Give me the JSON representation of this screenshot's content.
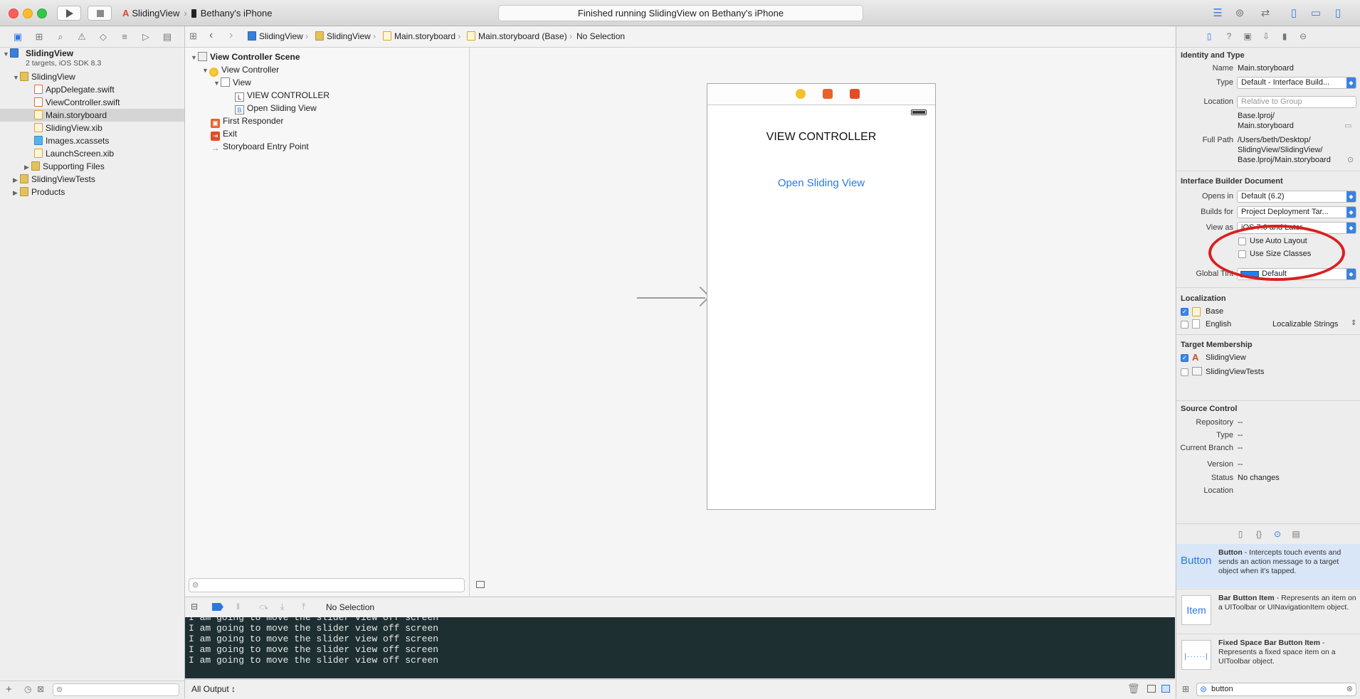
{
  "toolbar": {
    "scheme": "SlidingView",
    "device": "Bethany's iPhone",
    "activity": "Finished running SlidingView on Bethany's iPhone"
  },
  "navigator": {
    "project": {
      "name": "SlidingView",
      "subtitle": "2 targets, iOS SDK 8.3"
    },
    "items": [
      {
        "label": "SlidingView",
        "kind": "folder"
      },
      {
        "label": "AppDelegate.swift",
        "kind": "swift"
      },
      {
        "label": "ViewController.swift",
        "kind": "swift"
      },
      {
        "label": "Main.storyboard",
        "kind": "storyboard"
      },
      {
        "label": "SlidingView.xib",
        "kind": "xib"
      },
      {
        "label": "Images.xcassets",
        "kind": "assets"
      },
      {
        "label": "LaunchScreen.xib",
        "kind": "xib"
      },
      {
        "label": "Supporting Files",
        "kind": "folder"
      },
      {
        "label": "SlidingViewTests",
        "kind": "folder"
      },
      {
        "label": "Products",
        "kind": "folder"
      }
    ]
  },
  "jumpbar": [
    "SlidingView",
    "SlidingView",
    "Main.storyboard",
    "Main.storyboard (Base)",
    "No Selection"
  ],
  "outline": {
    "scene": "View Controller Scene",
    "view_controller": "View Controller",
    "view": "View",
    "label": "VIEW CONTROLLER",
    "button": "Open Sliding View",
    "first_responder": "First Responder",
    "exit": "Exit",
    "entry_point": "Storyboard Entry Point"
  },
  "canvas": {
    "title_label": "VIEW CONTROLLER",
    "button_label": "Open Sliding View"
  },
  "debug": {
    "selection": "No Selection",
    "console_lines": [
      "I am going to move the slider view off screen",
      "I am going to move the slider view off screen",
      "I am going to move the slider view off screen",
      "I am going to move the slider view off screen",
      "I am going to move the slider view off screen"
    ],
    "output_filter": "All Output ↕"
  },
  "inspector": {
    "identity": {
      "title": "Identity and Type",
      "name_label": "Name",
      "name": "Main.storyboard",
      "type_label": "Type",
      "type": "Default - Interface Build...",
      "location_label": "Location",
      "location": "Relative to Group",
      "location_path_1": "Base.lproj/",
      "location_path_2": "Main.storyboard",
      "full_path_label": "Full Path",
      "full_path_1": "/Users/beth/Desktop/",
      "full_path_2": "SlidingView/SlidingView/",
      "full_path_3": "Base.lproj/Main.storyboard"
    },
    "ib_document": {
      "title": "Interface Builder Document",
      "opens_in_label": "Opens in",
      "opens_in": "Default (6.2)",
      "builds_for_label": "Builds for",
      "builds_for": "Project Deployment Tar...",
      "view_as_label": "View as",
      "view_as": "iOS 7.0 and Later",
      "auto_layout": "Use Auto Layout",
      "size_classes": "Use Size Classes",
      "global_tint_label": "Global Tint",
      "global_tint": "Default"
    },
    "localization": {
      "title": "Localization",
      "base": "Base",
      "english": "English",
      "english_type": "Localizable Strings"
    },
    "target_membership": {
      "title": "Target Membership",
      "target1": "SlidingView",
      "target2": "SlidingViewTests"
    },
    "source_control": {
      "title": "Source Control",
      "repository_label": "Repository",
      "repository": "--",
      "type_label": "Type",
      "type": "--",
      "branch_label": "Current Branch",
      "branch": "--",
      "version_label": "Version",
      "version": "--",
      "status_label": "Status",
      "status": "No changes",
      "location_label": "Location"
    },
    "library": {
      "items": [
        {
          "thumb": "Button",
          "name": "Button",
          "desc": " - Intercepts touch events and sends an action message to a target object when it's tapped."
        },
        {
          "thumb": "Item",
          "name": "Bar Button Item",
          "desc": " - Represents an item on a UIToolbar or UINavigationItem object."
        },
        {
          "thumb": "",
          "name": "Fixed Space Bar Button Item",
          "desc": " - Represents a fixed space item on a UIToolbar object."
        }
      ],
      "search": "button"
    }
  },
  "colors": {
    "accent": "#2a78e4",
    "console_bg": "#1d2f31",
    "annotation": "#d92020"
  }
}
